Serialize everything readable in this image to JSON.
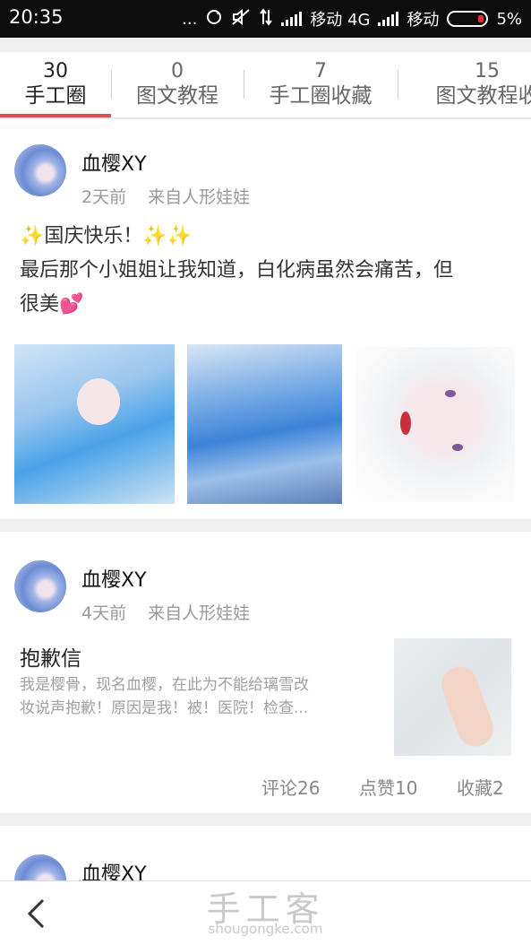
{
  "status_bar": {
    "time": "20:35",
    "dots": "...",
    "carrier1": "移动 4G",
    "carrier2": "移动",
    "battery": "5%"
  },
  "tabs": [
    {
      "count": "30",
      "label": "手工圈",
      "active": true
    },
    {
      "count": "0",
      "label": "图文教程",
      "active": false
    },
    {
      "count": "7",
      "label": "手工圈收藏",
      "active": false
    },
    {
      "count": "15",
      "label": "图文教程收",
      "active": false
    }
  ],
  "posts": [
    {
      "author": "血樱XY",
      "time": "2天前",
      "source": "来自人形娃娃",
      "line1_text": "国庆快乐！",
      "line2": "最后那个小姐姐让我知道，白化病虽然会痛苦，但",
      "line3_text": "很美"
    },
    {
      "author": "血樱XY",
      "time": "4天前",
      "source": "来自人形娃娃",
      "title": "抱歉信",
      "summary_line1": "我是樱骨，现名血樱，在此为不能给璃雪改",
      "summary_line2": "妆说声抱歉！原因是我！被！医院！检查...",
      "comments": "评论26",
      "likes": "点赞10",
      "favorites": "收藏2"
    },
    {
      "author": "血樱XY"
    }
  ],
  "watermark": {
    "cn": "手工客",
    "en": "shougongke.com"
  },
  "icons": {
    "back": "back-arrow-icon",
    "sparkle": "sparkle-icon",
    "heart": "hearts-icon"
  },
  "colors": {
    "accent": "#d9534f",
    "sparkle": "#f0b323",
    "heart": "#e25b9c"
  }
}
